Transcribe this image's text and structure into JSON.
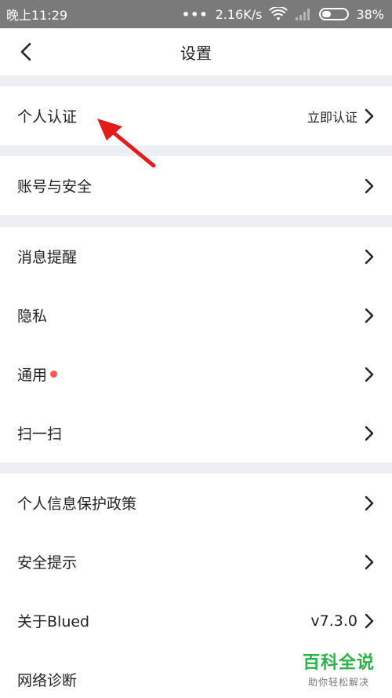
{
  "status_bar": {
    "time": "晚上11:29",
    "dots": "•••",
    "speed": "2.16K/s",
    "battery": "38%",
    "battery_level": 0.38
  },
  "header": {
    "title": "设置",
    "back_icon": "chevron-left-icon"
  },
  "rows": {
    "verify": {
      "label": "个人认证",
      "value": "立即认证"
    },
    "account": {
      "label": "账号与安全"
    },
    "notify": {
      "label": "消息提醒"
    },
    "privacy": {
      "label": "隐私"
    },
    "general": {
      "label": "通用",
      "badge_color": "#f25a4b"
    },
    "scan": {
      "label": "扫一扫"
    },
    "policy": {
      "label": "个人信息保护政策"
    },
    "safety": {
      "label": "安全提示"
    },
    "about": {
      "label": "关于Blued",
      "value": "v7.3.0"
    },
    "diag": {
      "label": "网络诊断"
    }
  },
  "annotation": {
    "color": "#e31b1b"
  },
  "watermark": {
    "title": "百科全说",
    "subtitle": "助你轻松解决",
    "color": "#2bb34a"
  }
}
